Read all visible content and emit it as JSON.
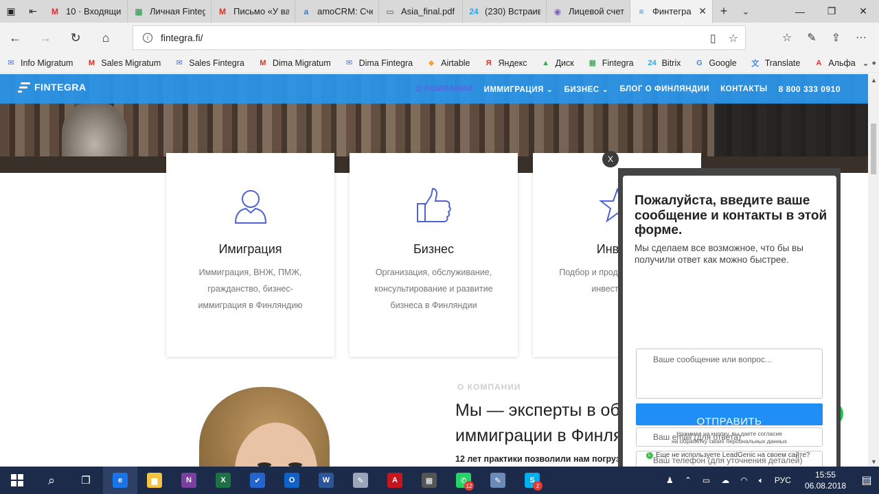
{
  "browser": {
    "tabs": [
      {
        "title": "10 · Входящие",
        "icon": "gmail-icon",
        "color": "#d93025",
        "glyph": "M"
      },
      {
        "title": "Личная Fintegra",
        "icon": "sheets-icon",
        "color": "#1e8e3e",
        "glyph": "▦"
      },
      {
        "title": "Письмо «У вас",
        "icon": "gmail-icon",
        "color": "#d93025",
        "glyph": "M"
      },
      {
        "title": "amoCRM: Счет",
        "icon": "amocrm-icon",
        "color": "#2d7be5",
        "glyph": "a"
      },
      {
        "title": "Asia_final.pdf",
        "icon": "pdf-icon",
        "color": "#555555",
        "glyph": "▭"
      },
      {
        "title": "(230) Встраивание",
        "icon": "bitrix-icon",
        "color": "#2fa5e0",
        "glyph": "24"
      },
      {
        "title": "Лицевой счет",
        "icon": "viber-icon",
        "color": "#7c5cbf",
        "glyph": "◉"
      },
      {
        "title": "Финтегра",
        "icon": "fintegra-icon",
        "color": "#2b8fe6",
        "glyph": "≡",
        "active": true
      }
    ],
    "url": "fintegra.fi/",
    "bookmarks": [
      {
        "label": "Info Migratum",
        "icon": "mail-icon",
        "color": "#4a6fd1",
        "glyph": "✉"
      },
      {
        "label": "Sales Migratum",
        "icon": "gmail-icon",
        "color": "#d93025",
        "glyph": "M"
      },
      {
        "label": "Sales Fintegra",
        "icon": "mail-icon",
        "color": "#4a6fd1",
        "glyph": "✉"
      },
      {
        "label": "Dima Migratum",
        "icon": "gmail-icon",
        "color": "#d93025",
        "glyph": "M"
      },
      {
        "label": "Dima Fintegra",
        "icon": "mail-icon",
        "color": "#4a6fd1",
        "glyph": "✉"
      },
      {
        "label": "Airtable",
        "icon": "airtable-icon",
        "color": "#f2a33c",
        "glyph": "◆"
      },
      {
        "label": "Яндекс",
        "icon": "yandex-icon",
        "color": "#e52b2b",
        "glyph": "Я"
      },
      {
        "label": "Диск",
        "icon": "drive-icon",
        "color": "#34a853",
        "glyph": "▲"
      },
      {
        "label": "Fintegra",
        "icon": "sheets-icon",
        "color": "#1e8e3e",
        "glyph": "▦"
      },
      {
        "label": "Bitrix",
        "icon": "bitrix-icon",
        "color": "#2fa5e0",
        "glyph": "24"
      },
      {
        "label": "Google",
        "icon": "google-icon",
        "color": "#4285f4",
        "glyph": "G"
      },
      {
        "label": "Translate",
        "icon": "translate-icon",
        "color": "#4285f4",
        "glyph": "文"
      },
      {
        "label": "Альфа",
        "icon": "alfa-icon",
        "color": "#ef3124",
        "glyph": "A"
      },
      {
        "label": "iCloud",
        "icon": "apple-icon",
        "color": "#666666",
        "glyph": "●"
      }
    ]
  },
  "site": {
    "logo": "FINTEGRA",
    "menu": [
      {
        "label": "О КОМПАНИИ",
        "active": true,
        "dropdown": false
      },
      {
        "label": "ИММИГРАЦИЯ",
        "active": false,
        "dropdown": true
      },
      {
        "label": "БИЗНЕС",
        "active": false,
        "dropdown": true
      },
      {
        "label": "БЛОГ О ФИНЛЯНДИИ",
        "active": false,
        "dropdown": false
      },
      {
        "label": "КОНТАКТЫ",
        "active": false,
        "dropdown": false
      }
    ],
    "phone": "8 800 333 0910",
    "cards": [
      {
        "title": "Имиграция",
        "icon": "user-icon",
        "text": "Иммиграция, ВНЖ, ПМЖ, гражданство, бизнес-иммиграция в Финляндию"
      },
      {
        "title": "Бизнес",
        "icon": "thumbs-up-icon",
        "text": "Организация, обслуживание, консультирование и развитие бизнеса в Финляндии"
      },
      {
        "title": "Инвест",
        "icon": "star-icon",
        "text": "Подбор и прод доходной нед инвестицион"
      }
    ],
    "about": {
      "label": "О КОМПАНИИ",
      "title_line1": "Мы — эксперты в обл",
      "title_line2": "иммиграции в Финля",
      "subtitle": "12 лет практики позволили нам погрузит"
    }
  },
  "popup": {
    "close": "X",
    "title": "Пожалуйста, введите ваше сообщение и контакты в этой форме.",
    "lead": "Мы сделаем все возможное, что бы вы получили ответ как можно быстрее.",
    "message_placeholder": "Ваше сообщение или вопрос...",
    "name_placeholder": "Ваше имя",
    "email_placeholder": "Ваш email (для ответа)",
    "phone_placeholder": "Ваш телефон (для уточнения деталей)",
    "submit": "ОТПРАВИТЬ",
    "consent_line1": "Нажимая на кнопку, вы даете согласие",
    "consent_line2": "на обработку своих персональных данных",
    "leadgenic": "Еще не используете LeadGenic на своем сайте?"
  },
  "taskbar": {
    "apps": [
      {
        "name": "edge",
        "icon": "edge-icon",
        "color": "#1a73e8",
        "glyph": "e",
        "active": true
      },
      {
        "name": "explorer",
        "icon": "folder-icon",
        "color": "#f4c542",
        "glyph": "▆"
      },
      {
        "name": "onenote",
        "icon": "onenote-icon",
        "color": "#7b3fa0",
        "glyph": "N"
      },
      {
        "name": "excel",
        "icon": "excel-icon",
        "color": "#1e7145",
        "glyph": "X"
      },
      {
        "name": "todo",
        "icon": "checkmark-icon",
        "color": "#2564cf",
        "glyph": "✔"
      },
      {
        "name": "outlook",
        "icon": "outlook-icon",
        "color": "#0f63c8",
        "glyph": "O"
      },
      {
        "name": "word",
        "icon": "word-icon",
        "color": "#2b579a",
        "glyph": "W"
      },
      {
        "name": "paint",
        "icon": "palette-icon",
        "color": "#9aa7b8",
        "glyph": "✎"
      },
      {
        "name": "acrobat",
        "icon": "acrobat-icon",
        "color": "#c4161c",
        "glyph": "A"
      },
      {
        "name": "calculator",
        "icon": "calculator-icon",
        "color": "#555555",
        "glyph": "▦"
      },
      {
        "name": "whatsapp",
        "icon": "whatsapp-icon",
        "color": "#25d366",
        "glyph": "✆",
        "badge": "12"
      },
      {
        "name": "notepad",
        "icon": "notepad-icon",
        "color": "#6b8ab8",
        "glyph": "✎"
      },
      {
        "name": "skype",
        "icon": "skype-icon",
        "color": "#00aff0",
        "glyph": "S",
        "badge": "2"
      }
    ],
    "lang": "РУС",
    "time": "15:55",
    "date": "06.08.2018"
  }
}
